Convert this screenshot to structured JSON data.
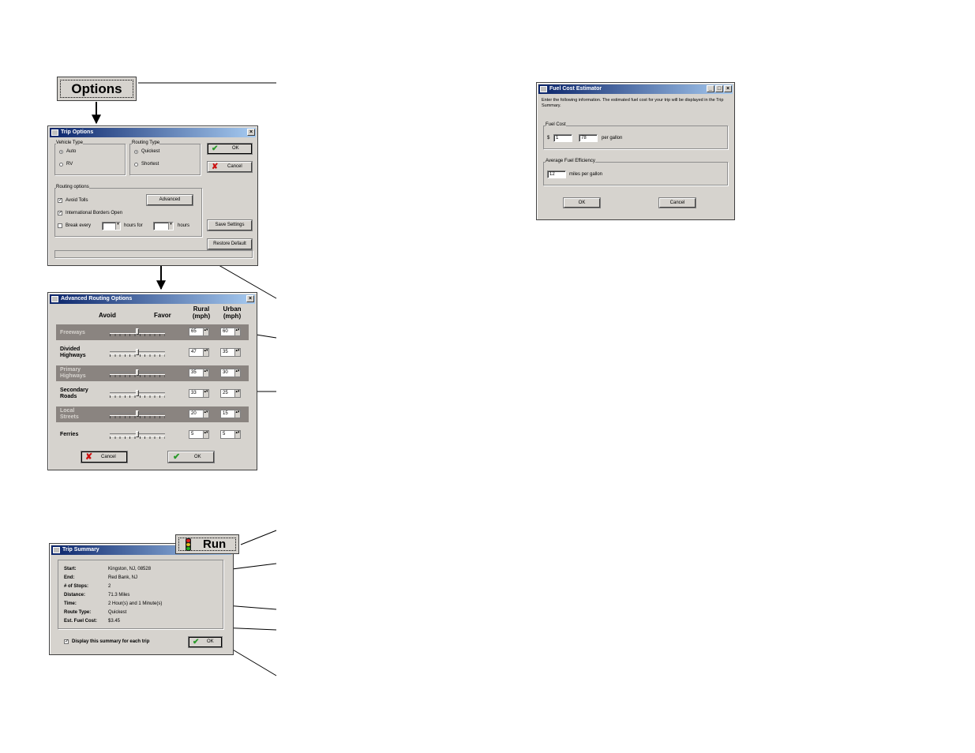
{
  "options_button": {
    "label": "Options"
  },
  "run_button": {
    "label": "Run"
  },
  "trip_options": {
    "title": "Trip Options",
    "vehicle_type": {
      "label": "Vehicle Type",
      "auto": "Auto",
      "rv": "RV"
    },
    "routing_type": {
      "label": "Routing Type",
      "quickest": "Quickest",
      "shortest": "Shortest"
    },
    "ok": "OK",
    "cancel": "Cancel",
    "routing_options": {
      "label": "Routing options",
      "avoid_tolls": "Avoid Tolls",
      "international_borders": "International Borders Open",
      "advanced": "Advanced",
      "break_every": "Break every",
      "hours_for": "hours for",
      "hours": "hours"
    },
    "save_settings": "Save Settings",
    "restore_default": "Restore Default"
  },
  "advanced_routing": {
    "title": "Advanced Routing Options",
    "col_avoid": "Avoid",
    "col_favor": "Favor",
    "col_rural": "Rural\n(mph)",
    "col_urban": "Urban\n(mph)",
    "rows": [
      {
        "label": "Freeways",
        "rural": "65",
        "urban": "60",
        "slider": 0.5
      },
      {
        "label": "Divided\nHighways",
        "rural": "47",
        "urban": "35",
        "slider": 0.5
      },
      {
        "label": "Primary\nHighways",
        "rural": "35",
        "urban": "30",
        "slider": 0.5
      },
      {
        "label": "Secondary\nRoads",
        "rural": "33",
        "urban": "25",
        "slider": 0.5
      },
      {
        "label": "Local\nStreets",
        "rural": "20",
        "urban": "15",
        "slider": 0.5
      },
      {
        "label": "Ferries",
        "rural": "5",
        "urban": "5",
        "slider": 0.5
      }
    ],
    "cancel": "Cancel",
    "ok": "OK"
  },
  "trip_summary": {
    "title": "Trip Summary",
    "labels": [
      "Start:",
      "End:",
      "# of Stops:",
      "Distance:",
      "Time:",
      "Route Type:",
      "Est. Fuel Cost:"
    ],
    "values": [
      "Kingston, NJ, 08528",
      "Red Bank, NJ",
      "2",
      "71.3 Miles",
      "2 Hour(s) and 1 Minute(s)",
      "Quickest",
      "$3.45"
    ],
    "display_summary": "Display this summary for each trip",
    "ok": "OK"
  },
  "fuel_cost": {
    "title": "Fuel Cost Estimator",
    "instructions": "Enter the following information. The estimated fuel cost for your trip will be displayed in the Trip Summary.",
    "fuel_cost_label": "Fuel Cost",
    "dollar": "$",
    "dollars": "1",
    "cents": "78",
    "per_gallon": "per gallon",
    "efficiency_label": "Average Fuel Efficiency",
    "mpg": "12",
    "miles_per_gallon": "miles per gallon",
    "ok": "OK",
    "cancel": "Cancel"
  },
  "colors": {
    "title_start": "#0a246a",
    "title_end": "#a6caf0",
    "dialog": "#d6d3ce",
    "dark_row": "#8a8480"
  }
}
